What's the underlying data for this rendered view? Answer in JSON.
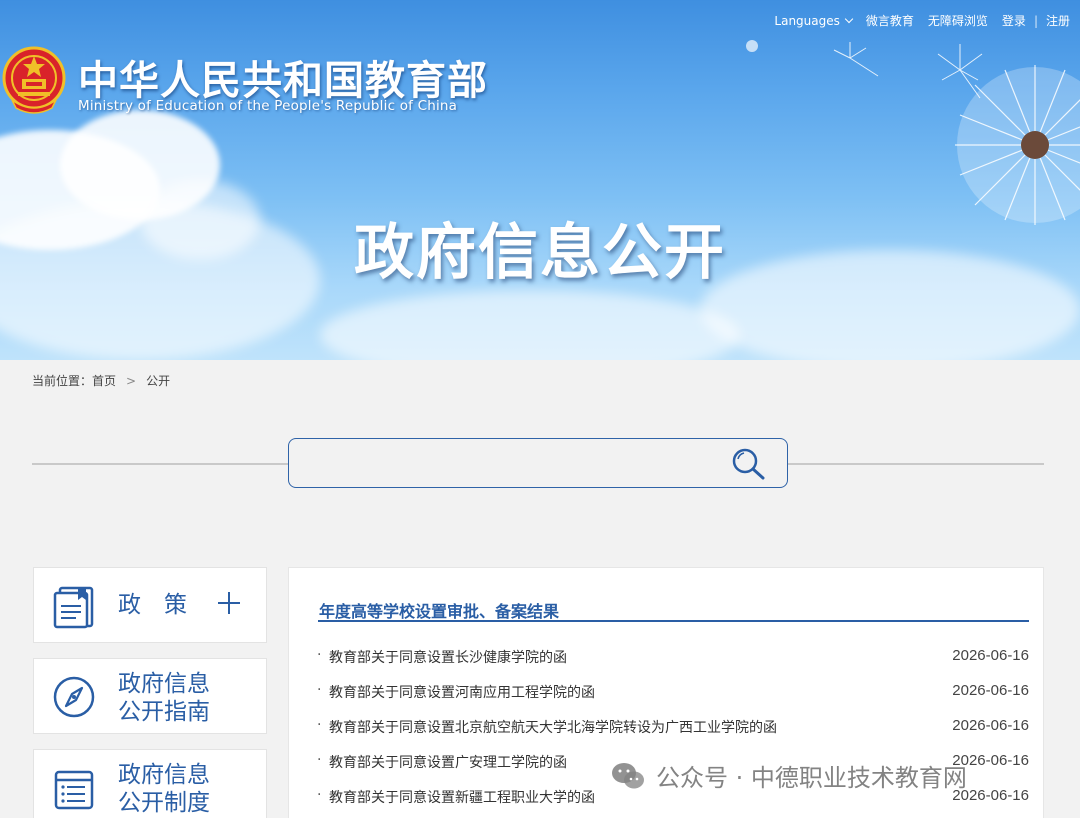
{
  "header": {
    "logo_cn": "中华人民共和国教育部",
    "logo_en": "Ministry of Education of the People's Republic of China",
    "links": {
      "languages": "Languages",
      "weiyan": "微言教育",
      "accessible": "无障碍浏览",
      "login": "登录",
      "separator": "|",
      "register": "注册"
    },
    "banner_title": "政府信息公开"
  },
  "breadcrumb": {
    "prefix": "当前位置：",
    "home": "首页",
    "arrow": ">",
    "current": "公开"
  },
  "search": {
    "value": "",
    "placeholder": ""
  },
  "sidebar": {
    "items": [
      {
        "line1": "政　策",
        "line2": "",
        "icon": "policy-document-icon"
      },
      {
        "line1": "政府信息",
        "line2": "公开指南",
        "icon": "compass-icon"
      },
      {
        "line1": "政府信息",
        "line2": "公开制度",
        "icon": "list-document-icon"
      }
    ]
  },
  "main": {
    "section_title": "年度高等学校设置审批、备案结果",
    "bullet": "·",
    "items": [
      {
        "title": "教育部关于同意设置长沙健康学院的函",
        "date": "2026-06-16"
      },
      {
        "title": "教育部关于同意设置河南应用工程学院的函",
        "date": "2026-06-16"
      },
      {
        "title": "教育部关于同意设置北京航空航天大学北海学院转设为广西工业学院的函",
        "date": "2026-06-16"
      },
      {
        "title": "教育部关于同意设置广安理工学院的函",
        "date": "2026-06-16"
      },
      {
        "title": "教育部关于同意设置新疆工程职业大学的函",
        "date": "2026-06-16"
      }
    ]
  },
  "watermark": {
    "text": "公众号 · 中德职业技术教育网",
    "icon": "wechat-icon"
  },
  "colors": {
    "accent": "#2a5ea5",
    "sky_top": "#3f8fe0",
    "sky_bottom": "#bfe3fb",
    "background": "#f2f2f2"
  }
}
